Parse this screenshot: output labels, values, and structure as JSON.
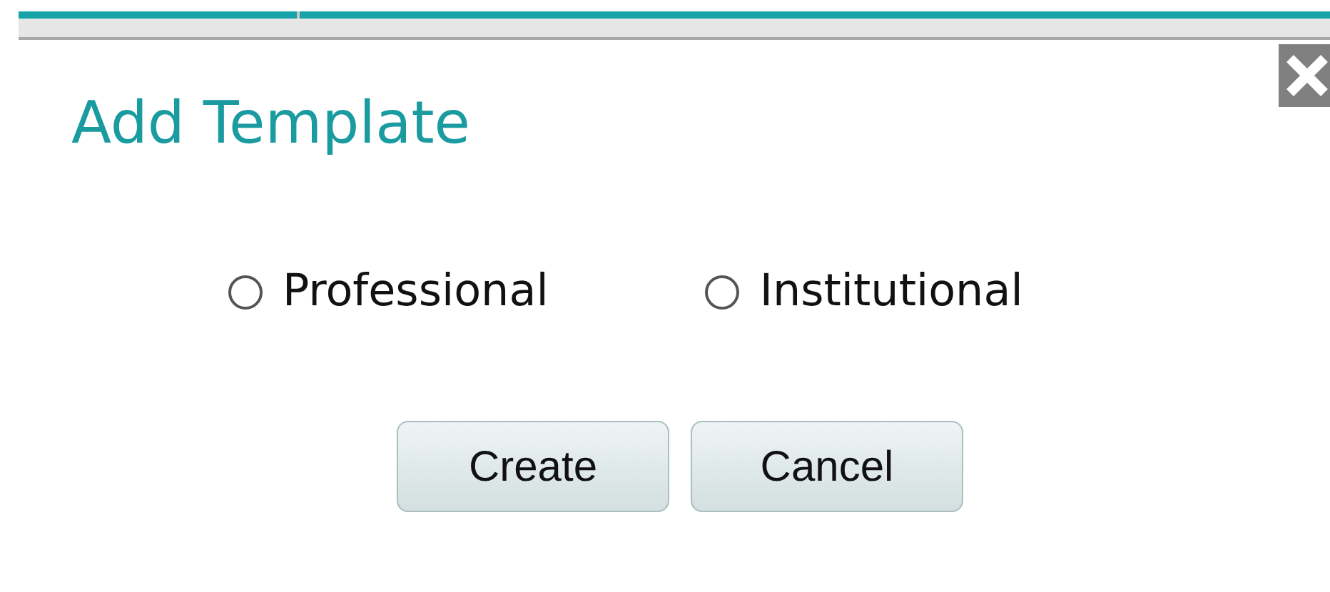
{
  "dialog": {
    "title": "Add Template",
    "options": [
      {
        "label": "Professional",
        "selected": false
      },
      {
        "label": "Institutional",
        "selected": false
      }
    ],
    "buttons": [
      "Create",
      "Cancel"
    ]
  }
}
